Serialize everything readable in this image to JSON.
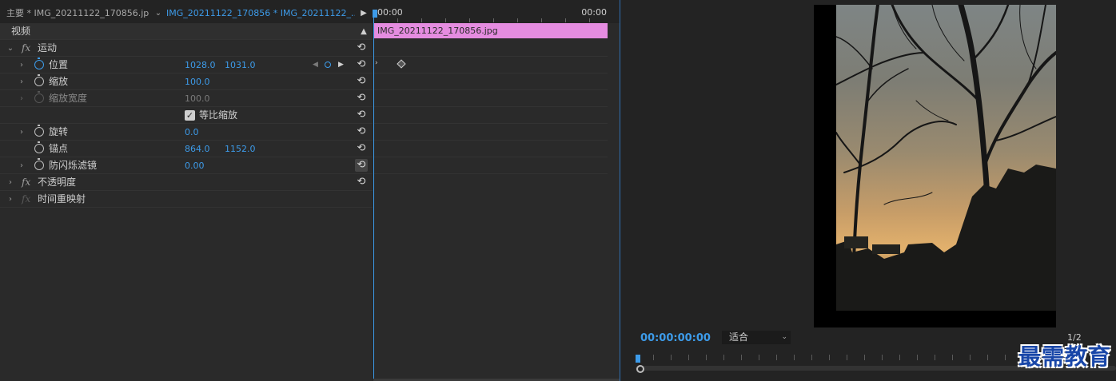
{
  "tabs": {
    "master": "主要 * IMG_20211122_170856.jpg",
    "sequence": "IMG_20211122_170856 * IMG_20211122_..."
  },
  "section_video": "视频",
  "ruler": {
    "start": "00:00",
    "end": "00:00"
  },
  "clip_name": "IMG_20211122_170856.jpg",
  "effects": {
    "motion": "运动",
    "position": {
      "label": "位置",
      "x": "1028.0",
      "y": "1031.0"
    },
    "scale": {
      "label": "缩放",
      "value": "100.0"
    },
    "scale_width": {
      "label": "缩放宽度",
      "value": "100.0"
    },
    "uniform_scale": {
      "label": "等比缩放",
      "checked": true
    },
    "rotation": {
      "label": "旋转",
      "value": "0.0"
    },
    "anchor": {
      "label": "锚点",
      "x": "864.0",
      "y": "1152.0"
    },
    "anti_flicker": {
      "label": "防闪烁滤镜",
      "value": "0.00"
    },
    "opacity": "不透明度",
    "time_remap": "时间重映射"
  },
  "monitor": {
    "timecode": "00:00:00:00",
    "fit": "适合",
    "fraction": "1/2"
  },
  "watermark": "最需教育",
  "colors": {
    "accent": "#3d9be9",
    "clip": "#e58ce0",
    "watermark": "#1846a8"
  }
}
